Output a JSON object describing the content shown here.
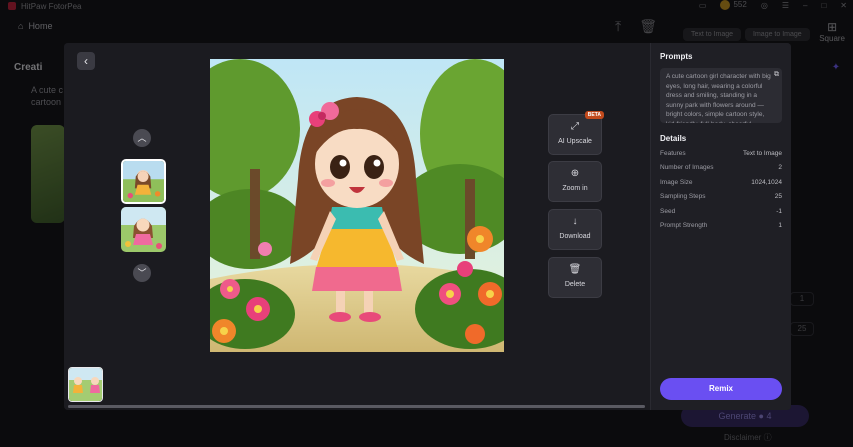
{
  "app": {
    "title": "HitPaw FotorPea",
    "coins": "552"
  },
  "nav": {
    "home_label": "Home",
    "square_label": "Square",
    "tab_text_to_image": "Text to Image",
    "tab_image_to_image": "Image to Image"
  },
  "background": {
    "creation_heading": "Creati",
    "desc_line1": "A cute c",
    "desc_line2": "cartoon",
    "generate_label": "Generate",
    "generate_cost": "4",
    "disclaimer_label": "Disclaimer",
    "stub_value_1": "1",
    "stub_value_2": "25"
  },
  "viewer": {
    "tools": [
      {
        "label": "AI Upscale",
        "badge": "BETA",
        "icon": "upscale-icon"
      },
      {
        "label": "Zoom in",
        "icon": "zoom-in-icon"
      },
      {
        "label": "Download",
        "icon": "download-icon"
      },
      {
        "label": "Delete",
        "icon": "trash-icon"
      }
    ]
  },
  "panel": {
    "prompts_heading": "Prompts",
    "prompt_text": "A cute cartoon girl character with big eyes, long hair, wearing a colorful dress and smiling, standing in a sunny park with flowers around — bright colors, simple cartoon style, kid-friendly, full-body, cheerful expression",
    "details_heading": "Details",
    "details": [
      {
        "label": "Features",
        "value": "Text to Image"
      },
      {
        "label": "Number of Images",
        "value": "2"
      },
      {
        "label": "Image Size",
        "value": "1024,1024"
      },
      {
        "label": "Sampling Steps",
        "value": "25"
      },
      {
        "label": "Seed",
        "value": "-1"
      },
      {
        "label": "Prompt Strength",
        "value": "1"
      }
    ],
    "remix_label": "Remix"
  },
  "colors": {
    "accent": "#6a4ff2",
    "beta_badge": "#c24a1c"
  }
}
